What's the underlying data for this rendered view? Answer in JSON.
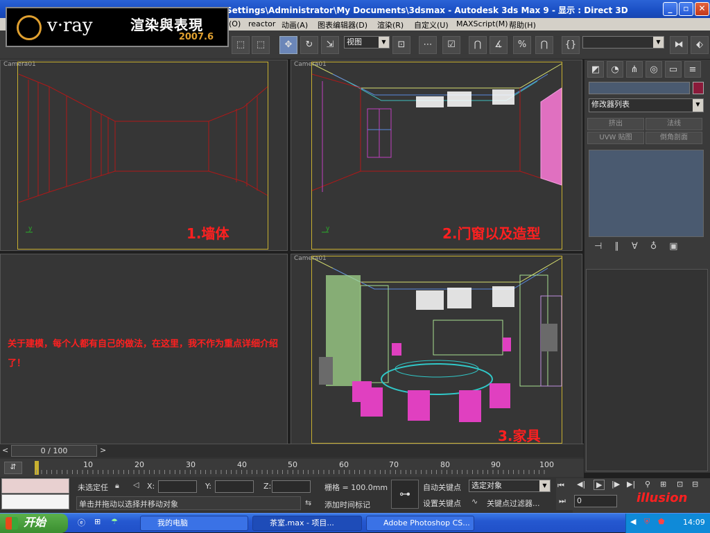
{
  "window": {
    "title": "Settings\\Administrator\\My Documents\\3dsmax   - Autodesk 3ds Max 9    - 显示 : Direct 3D",
    "minimize": "_",
    "maximize": "▫",
    "close": "✕"
  },
  "logo": {
    "brand": "v·ray",
    "chinese": "渲染與表現",
    "version": "2007.6"
  },
  "menu": [
    "(O)",
    "reactor",
    "动画(A)",
    "图表编辑器(D)",
    "渲染(R)",
    "自定义(U)",
    "MAXScript(M)",
    "帮助(H)"
  ],
  "toolbar": {
    "view_dropdown": "视图"
  },
  "viewports": [
    {
      "label": "Camera01",
      "note": "1.墙体"
    },
    {
      "label": "Camera01",
      "note": "2.门窗以及造型"
    },
    {
      "label": "",
      "note": "关于建模，每个人都有自己的做法，在这里，我不作为重点详细介绍了！"
    },
    {
      "label": "Camera01",
      "note": "3.家具"
    }
  ],
  "command_panel": {
    "modifier_list": "修改器列表",
    "buttons": [
      "挤出",
      "法线",
      "UVW 贴图",
      "倒角剖面"
    ]
  },
  "timeline": {
    "frame": "0 / 100",
    "ticks": [
      "10",
      "20",
      "30",
      "40",
      "50",
      "60",
      "70",
      "80",
      "90",
      "100"
    ]
  },
  "status": {
    "selection": "未选定任",
    "x_label": "X:",
    "y_label": "Y:",
    "z_label": "Z:",
    "grid": "栅格 = 100.0mm",
    "auto_key": "自动关键点",
    "set_key": "设置关键点",
    "selected_object": "选定对象",
    "key_filter": "关键点过滤器...",
    "prompt": "单击并拖动以选择并移动对象",
    "add_time_tag": "添加时间标记",
    "current_frame": "0"
  },
  "taskbar": {
    "start": "开始",
    "tasks": [
      "我的电脑",
      "茶室.max   - 项目...",
      "Adobe Photoshop CS..."
    ],
    "clock": "14:09",
    "watermark": "illusion"
  },
  "colors": {
    "note_red": "#ff2020",
    "frame_gold": "#c8b030",
    "xp_blue": "#2558d0"
  }
}
